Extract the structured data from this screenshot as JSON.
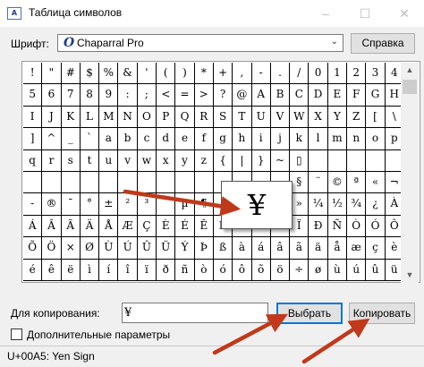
{
  "window": {
    "title": "Таблица символов",
    "min_glyph": "–",
    "max_glyph": "☐",
    "close_glyph": "✕"
  },
  "font_row": {
    "label": "Шрифт:",
    "font_icon": "O",
    "font_name": "Chaparral Pro",
    "dropdown_glyph": "⌄",
    "help_button": "Справка"
  },
  "grid": {
    "rows": [
      [
        "!",
        "\"",
        "#",
        "$",
        "%",
        "&",
        "'",
        "(",
        ")",
        "*",
        "+",
        ",",
        "-",
        ".",
        "/",
        "0",
        "1",
        "2",
        "3",
        "4"
      ],
      [
        "5",
        "6",
        "7",
        "8",
        "9",
        ":",
        ";",
        "<",
        "=",
        ">",
        "?",
        "@",
        "A",
        "B",
        "C",
        "D",
        "E",
        "F",
        "G",
        "H"
      ],
      [
        "I",
        "J",
        "K",
        "L",
        "M",
        "N",
        "O",
        "P",
        "Q",
        "R",
        "S",
        "T",
        "U",
        "V",
        "W",
        "X",
        "Y",
        "Z",
        "[",
        "\\"
      ],
      [
        "]",
        "^",
        "_",
        "`",
        "a",
        "b",
        "c",
        "d",
        "e",
        "f",
        "g",
        "h",
        "i",
        "j",
        "k",
        "l",
        "m",
        "n",
        "o",
        "p"
      ],
      [
        "q",
        "r",
        "s",
        "t",
        "u",
        "v",
        "w",
        "x",
        "y",
        "z",
        "{",
        "|",
        "}",
        "~",
        "▯",
        "",
        "",
        "",
        "",
        ""
      ],
      [
        "",
        "",
        "",
        "",
        "",
        "",
        "",
        "",
        "",
        "",
        "",
        "",
        "",
        "",
        "§",
        "¨",
        "©",
        "ª",
        "«",
        "¬"
      ],
      [
        "-",
        "®",
        "¯",
        "°",
        "±",
        "²",
        "³",
        "´",
        "µ",
        "¶",
        "",
        "",
        "",
        "",
        "»",
        "¼",
        "½",
        "¾",
        "¿",
        "À"
      ],
      [
        "Á",
        "Â",
        "Ã",
        "Ä",
        "Å",
        "Æ",
        "Ç",
        "È",
        "É",
        "Ê",
        "Ë",
        "Ì",
        "Í",
        "Î",
        "Ï",
        "Ð",
        "Ñ",
        "Ò",
        "Ó",
        "Ô"
      ],
      [
        "Õ",
        "Ö",
        "×",
        "Ø",
        "Ù",
        "Ú",
        "Û",
        "Ü",
        "Ý",
        "Þ",
        "ß",
        "à",
        "á",
        "â",
        "ã",
        "ä",
        "å",
        "æ",
        "ç",
        "è"
      ],
      [
        "é",
        "ê",
        "ë",
        "ì",
        "í",
        "î",
        "ï",
        "ð",
        "ñ",
        "ò",
        "ó",
        "ô",
        "õ",
        "ö",
        "÷",
        "ø",
        "ù",
        "ú",
        "û",
        "ü"
      ]
    ],
    "magnified_char": "¥",
    "scroll_up_glyph": "▲",
    "scroll_down_glyph": "▼"
  },
  "copy_row": {
    "label": "Для копирования:",
    "value": "¥",
    "select_button": "Выбрать",
    "copy_button": "Копировать"
  },
  "advanced": {
    "label": "Дополнительные параметры",
    "checked": false
  },
  "status": {
    "text": "U+00A5: Yen Sign"
  },
  "colors": {
    "annotation_arrow": "#c0391b",
    "focus_border": "#0078d7"
  }
}
